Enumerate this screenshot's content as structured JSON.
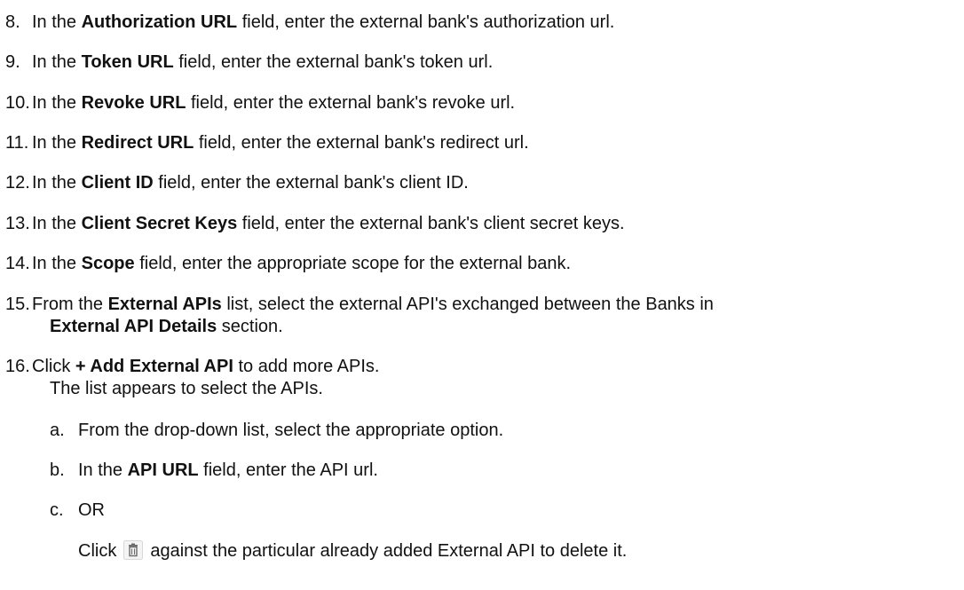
{
  "steps": [
    {
      "num": "8.",
      "pre": "In the ",
      "bold": "Authorization URL",
      "post": " field, enter the external bank's authorization url."
    },
    {
      "num": "9.",
      "pre": "In the ",
      "bold": "Token URL",
      "post": " field, enter the external bank's token url."
    },
    {
      "num": "10.",
      "pre": "In the ",
      "bold": "Revoke URL",
      "post": " field, enter the external bank's revoke url."
    },
    {
      "num": "11.",
      "pre": "In the ",
      "bold": "Redirect URL",
      "post": " field, enter the external bank's redirect url."
    },
    {
      "num": "12.",
      "pre": "In the ",
      "bold": "Client ID",
      "post": " field, enter the external bank's client ID."
    },
    {
      "num": "13.",
      "pre": "In the ",
      "bold": "Client Secret Keys",
      "post": " field, enter the external bank's client secret keys."
    },
    {
      "num": "14.",
      "pre": "In the ",
      "bold": "Scope",
      "post": " field, enter the appropriate scope for the external bank."
    },
    {
      "num": "15.",
      "pre": "From the ",
      "bold": "External APIs",
      "post": " list, select the external API's exchanged between the Banks in",
      "cont_bold": "External API Details",
      "cont_post": " section."
    },
    {
      "num": "16.",
      "pre": "Click ",
      "bold": "+ Add External API",
      "post": " to add more APIs.",
      "cont_post": "The list appears to select the APIs."
    }
  ],
  "substeps": [
    {
      "letter": "a.",
      "pre": "From the drop-down list, select the appropriate option."
    },
    {
      "letter": "b.",
      "pre": "In the ",
      "bold": "API URL",
      "post": " field, enter the API url."
    },
    {
      "letter": "c.",
      "pre": "OR"
    }
  ],
  "delete_line": {
    "pre": "Click",
    "icon": "trash-icon",
    "post": "against the particular already added External API to delete it."
  }
}
